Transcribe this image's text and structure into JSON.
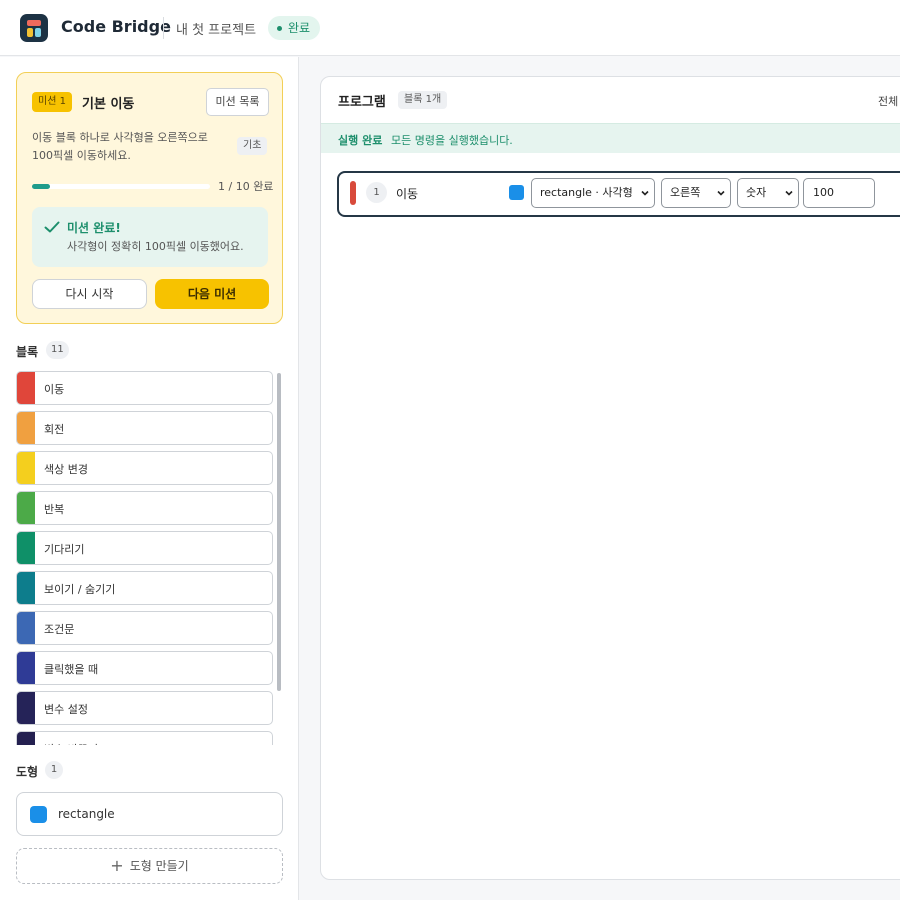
{
  "header": {
    "app_title": "Code Bridge",
    "project_name": "내 첫 프로젝트",
    "status": "완료"
  },
  "mission": {
    "badge": "미션 1",
    "title": "기본 이동",
    "list_button": "미션 목록",
    "description": "이동 블록 하나로 사각형을 오른쪽으로 100픽셀 이동하세요.",
    "level": "기초",
    "progress_fraction": 0.1,
    "progress_text": "1 / 10 완료",
    "complete_title": "미션 완료!",
    "complete_message": "사각형이 정확히 100픽셀 이동했어요.",
    "restart_button": "다시 시작",
    "next_button": "다음 미션"
  },
  "blocks": {
    "label": "블록",
    "count": "11",
    "items": [
      {
        "label": "이동",
        "color": "#e0463a"
      },
      {
        "label": "회전",
        "color": "#f0a040"
      },
      {
        "label": "색상 변경",
        "color": "#f4cf1e"
      },
      {
        "label": "반복",
        "color": "#4caa48"
      },
      {
        "label": "기다리기",
        "color": "#0f9068"
      },
      {
        "label": "보이기 / 숨기기",
        "color": "#0d7d8c"
      },
      {
        "label": "조건문",
        "color": "#3c68b4"
      },
      {
        "label": "클릭했을 때",
        "color": "#2f3b96"
      },
      {
        "label": "변수 설정",
        "color": "#252358"
      },
      {
        "label": "변수 바꾸기",
        "color": "#242050"
      }
    ]
  },
  "shapes": {
    "label": "도형",
    "count": "1",
    "items": [
      {
        "name": "rectangle",
        "color": "#1a8fe8"
      }
    ],
    "make_button": "도형 만들기"
  },
  "program": {
    "title": "프로그램",
    "count": "블록 1개",
    "right_label": "전체",
    "run_title": "실행 완료",
    "run_message": "모든 명령을 실행했습니다.",
    "rows": [
      {
        "number": "1",
        "label": "이동",
        "target": "rectangle · 사각형",
        "direction": "오른쪽",
        "value_type": "숫자",
        "value": "100"
      }
    ]
  }
}
